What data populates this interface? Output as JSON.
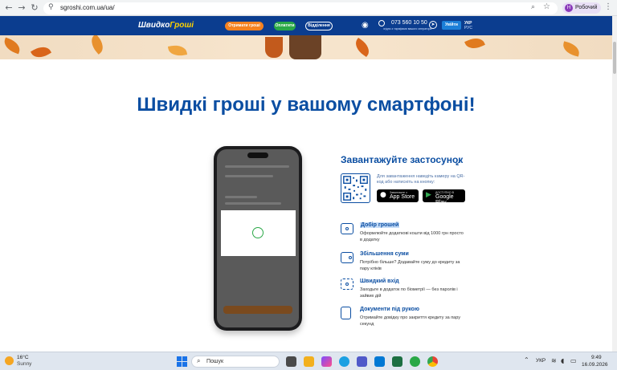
{
  "browser": {
    "url": "sgroshi.com.ua/ua/",
    "profile_initial": "H",
    "profile_name": "Робочий"
  },
  "header": {
    "logo_part1": "Швидко",
    "logo_part2": "Гроші",
    "get_money_label": "Отримати гроші",
    "pay_label": "Оплатити",
    "branches_label": "Відділення",
    "phone": "073 560 10 50",
    "phone_sub": "згідно з тарифами вашого оператора",
    "login_label": "Увійти",
    "lang_active": "УКР",
    "lang_other": "РУС"
  },
  "main": {
    "headline": "Швидкі гроші у вашому смартфоні!",
    "download_title": "Завантажуйте застосунок",
    "qr_text": "Для завантаження наведіть камеру на QR-код або натисніть на кнопку:",
    "appstore_small": "Завантажте з",
    "appstore_big": "App Store",
    "gplay_small": "ДОСТУПНО В",
    "gplay_big": "Google Play",
    "features": [
      {
        "title": "Добір грошей",
        "desc": "Оформлюйте додаткові кошти від 1000 грн просто в додатку"
      },
      {
        "title": "Збільшення суми",
        "desc": "Потрібно більше? Додавайте суму до кредиту за пару кліків"
      },
      {
        "title": "Швидкий вхід",
        "desc": "Заходьте в додаток по біометрії — без паролів і зайвих дій"
      },
      {
        "title": "Документи під рукою",
        "desc": "Отримайте довідку про закриття кредиту за пару секунд"
      }
    ]
  },
  "taskbar": {
    "temp": "16°C",
    "condition": "Sunny",
    "search_placeholder": "Пошук",
    "lang": "УКР",
    "time": "9:49",
    "date": "16.09.2026"
  },
  "colors": {
    "brand_blue": "#0b3d8f",
    "headline_blue": "#0b4ea2",
    "orange": "#f58220",
    "green": "#2aa847"
  }
}
